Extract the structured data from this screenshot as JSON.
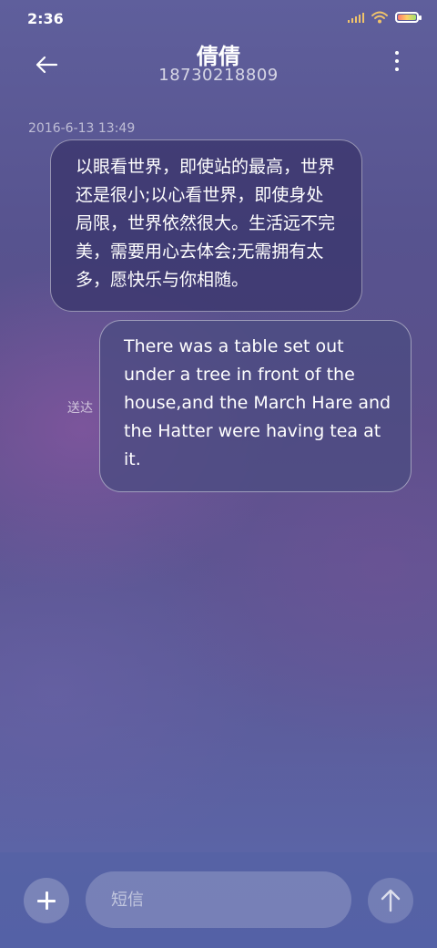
{
  "status_bar": {
    "time": "2:36",
    "icons": [
      "signal-icon",
      "wifi-icon",
      "battery-icon"
    ],
    "battery_level": 0.9,
    "accent": "#f0c36a"
  },
  "header": {
    "contact_name": "倩倩",
    "contact_number": "18730218809",
    "back_icon": "arrow-left-icon",
    "menu_icon": "more-vertical-icon"
  },
  "conversation": {
    "timestamp": "2016-6-13 13:49",
    "messages": [
      {
        "direction": "received",
        "lines": [
          "以眼看世界，即使站的最高，世界",
          "还是很小;以心看世界，即使身处",
          "局限，世界依然很大。生活远不完",
          "美，需要用心去体会;无需拥有太",
          "多，愿快乐与你相随。"
        ]
      },
      {
        "direction": "sent",
        "status": "送达",
        "lines": [
          "There was a table set out",
          "under a tree in front of the",
          "house,and the March Hare and",
          "the Hatter were having tea at",
          "it."
        ]
      }
    ]
  },
  "composer": {
    "placeholder": "短信",
    "add_icon": "plus-icon",
    "send_icon": "arrow-up-icon"
  }
}
